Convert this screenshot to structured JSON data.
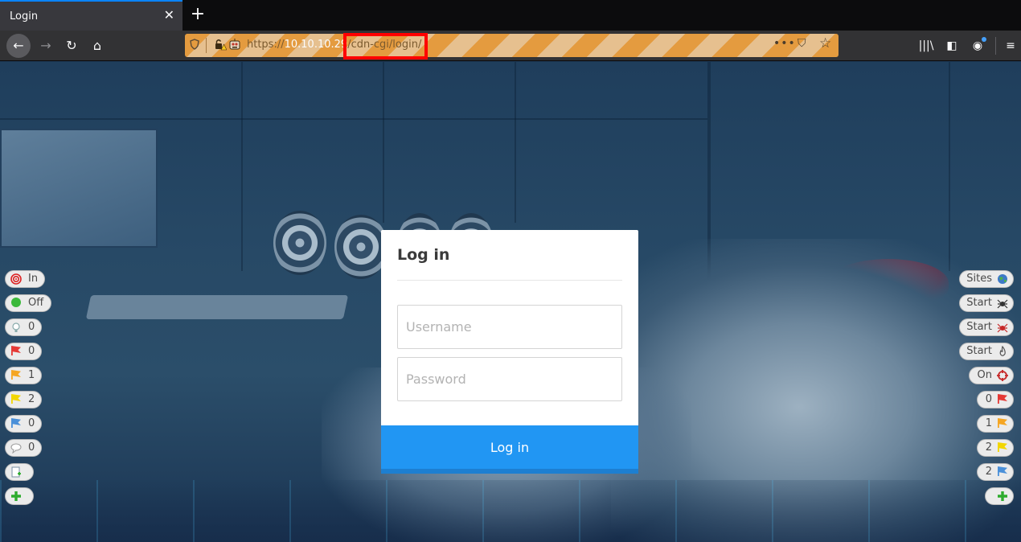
{
  "tab": {
    "title": "Login",
    "close_glyph": "✕"
  },
  "newtab_glyph": "+",
  "nav": {
    "back_glyph": "←",
    "forward_glyph": "→",
    "reload_glyph": "↻",
    "home_glyph": "⌂"
  },
  "urlbar": {
    "scheme": "https://",
    "host": "10.10.10.2",
    "host_hidden": "9",
    "path": "/cdn-cgi/login/",
    "more_glyph": "•••",
    "pocket_glyph": "⛉",
    "star_glyph": "☆"
  },
  "toolbar": {
    "library_glyph": "|||\\",
    "sidebar_glyph": "◧",
    "account_glyph": "◉",
    "menu_glyph": "≡"
  },
  "login": {
    "title": "Log in",
    "username_placeholder": "Username",
    "password_placeholder": "Password",
    "button_label": "Log in"
  },
  "left_pills": [
    {
      "icon": "target-icon",
      "label": "In"
    },
    {
      "icon": "green-dot-icon",
      "label": "Off"
    },
    {
      "icon": "bulb-icon",
      "label": "0"
    },
    {
      "icon": "red-flag-icon",
      "label": "0"
    },
    {
      "icon": "orange-flag-icon",
      "label": "1"
    },
    {
      "icon": "yellow-flag-icon",
      "label": "2"
    },
    {
      "icon": "blue-flag-icon",
      "label": "0"
    },
    {
      "icon": "comment-icon",
      "label": "0"
    },
    {
      "icon": "new-note-icon",
      "label": ""
    },
    {
      "icon": "plus-icon",
      "label": ""
    }
  ],
  "right_pills": [
    {
      "icon": "globe-icon",
      "label": "Sites"
    },
    {
      "icon": "spider-icon",
      "label": "Start"
    },
    {
      "icon": "red-spider-icon",
      "label": "Start"
    },
    {
      "icon": "flame-icon",
      "label": "Start"
    },
    {
      "icon": "crosshair-icon",
      "label": "On"
    },
    {
      "icon": "red-flag-icon",
      "label": "0"
    },
    {
      "icon": "orange-flag-icon",
      "label": "1"
    },
    {
      "icon": "yellow-flag-icon",
      "label": "2"
    },
    {
      "icon": "blue-flag-icon",
      "label": "2"
    },
    {
      "icon": "plus-icon",
      "label": ""
    }
  ],
  "colors": {
    "accent_blue": "#2196f3",
    "highlight_red": "#ff0000",
    "flag_red": "#e53935",
    "flag_orange": "#f5a623",
    "flag_yellow": "#f2d600",
    "flag_blue": "#4a90d9",
    "plus_green": "#2eab2e"
  }
}
